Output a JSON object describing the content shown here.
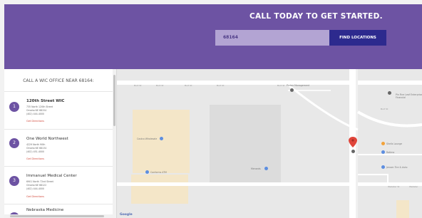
{
  "header": {
    "headline": "CALL TODAY TO GET STARTED.",
    "search_value": "68164",
    "find_button": "FIND LOCATIONS"
  },
  "panel": {
    "title": "CALL A WIC OFFICE NEAR 68164:",
    "entries": [
      {
        "number": "1",
        "name": "120th Street WIC",
        "address1": "735 North 120th Street",
        "address2": "Omaha NE 68154",
        "phone": "(402) 444-4000",
        "directions": "Get Directions"
      },
      {
        "number": "2",
        "name": "One World Northwest",
        "address1": "4229 North 90th",
        "address2": "Omaha NE 68134",
        "phone": "(402) 451-4000",
        "directions": "Get Directions"
      },
      {
        "number": "3",
        "name": "Immanuel Medical Center",
        "address1": "6901 North 72nd Street",
        "address2": "Omaha NE 68122",
        "phone": "(402) 444-4000",
        "directions": "Get Directions"
      },
      {
        "number": "4",
        "name": "Nebraska Medicine",
        "address1": "",
        "address2": "",
        "phone": "",
        "directions": ""
      }
    ]
  },
  "map": {
    "roads": [
      "Burt St",
      "Burt St",
      "Burt St",
      "Burt St",
      "Burt St",
      "Burt St",
      "Webster St",
      "Webster"
    ],
    "pois": [
      "Costco Wholesale",
      "Conforms ATM",
      "Menards",
      "Parker Management",
      "Pin Fine Leaf Enterprise Financial",
      "Shells Lounge",
      "Ratima",
      "Jensen Tire & Auto"
    ],
    "attribution": "Google"
  }
}
